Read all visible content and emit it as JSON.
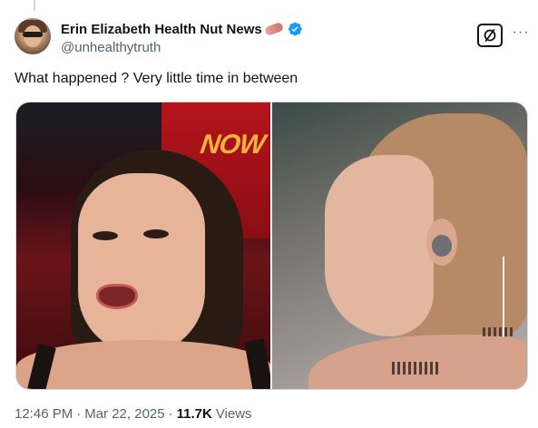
{
  "author": {
    "display_name": "Erin Elizabeth Health Nut News",
    "name_emoji": "peanut-emoji",
    "verified": true,
    "handle": "@unhealthytruth"
  },
  "header_actions": {
    "grok_icon": "grok-slash-circle-icon",
    "more_label": "···"
  },
  "tweet": {
    "text": "What happened ? Very little time in between"
  },
  "media": {
    "left_overlay_text": "NOW"
  },
  "meta": {
    "time": "12:46 PM",
    "separator": "·",
    "date": "Mar 22, 2025",
    "views_count": "11.7K",
    "views_label": "Views"
  },
  "colors": {
    "text_primary": "#0f1419",
    "text_secondary": "#536471",
    "verified_blue": "#1d9bf0",
    "now_yellow": "#f2b33d"
  }
}
